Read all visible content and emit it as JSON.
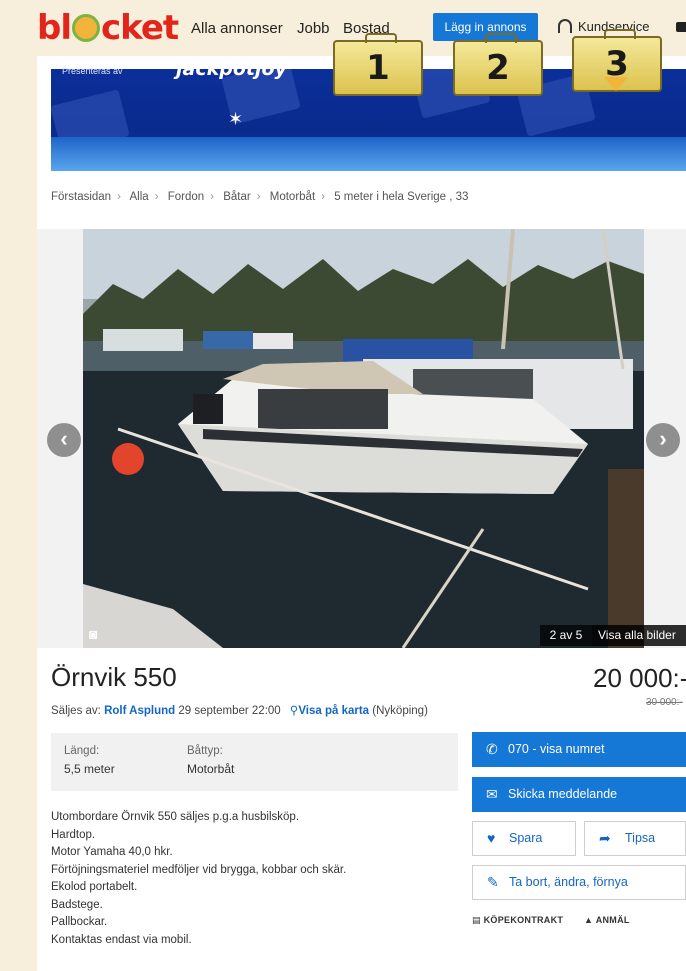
{
  "header": {
    "logo_text": "bl•cket",
    "nav": [
      "Alla annonser",
      "Jobb",
      "Bostad"
    ],
    "post_button": "Lägg in annons",
    "support": "Kundservice",
    "colors": {
      "brand": "#e2241a",
      "accent": "#1577d6"
    }
  },
  "banner": {
    "sponsor_prefix": "Presenteras av",
    "sponsor_name": "jackpotjoy",
    "cases": [
      "1",
      "2",
      "3"
    ]
  },
  "breadcrumb": [
    "Förstasidan",
    "Alla",
    "Fordon",
    "Båtar",
    "Motorbåt",
    "5 meter i hela Sverige , 33"
  ],
  "gallery": {
    "counter": "2 av 5",
    "view_all": "Visa alla bilder",
    "prev_icon": "chevron-left-icon",
    "next_icon": "chevron-right-icon"
  },
  "listing": {
    "title": "Örnvik 550",
    "price": "20 000:-",
    "old_price": "30 000:-",
    "seller_prefix": "Säljes av:",
    "seller": "Rolf Asplund",
    "date": "29 september 22:00",
    "map_link": "Visa på karta",
    "location": "(Nyköping)",
    "params": [
      {
        "label": "Längd:",
        "value": "5,5 meter"
      },
      {
        "label": "Båttyp:",
        "value": "Motorbåt"
      }
    ],
    "description": [
      "Utombordare Örnvik 550 säljes p.g.a husbilsköp.",
      "Hardtop.",
      "Motor Yamaha 40,0 hkr.",
      "Förtöjningsmateriel medföljer vid brygga, kobbar och skär.",
      "Ekolod portabelt.",
      "Badstege.",
      "Pallbockar.",
      "Kontaktas endast via mobil."
    ]
  },
  "actions": {
    "phone": "070 - visa numret",
    "message": "Skicka meddelande",
    "save": "Spara",
    "tip": "Tipsa",
    "edit": "Ta bort, ändra, förnya",
    "contract": "KÖPEKONTRAKT",
    "report": "ANMÄL"
  }
}
